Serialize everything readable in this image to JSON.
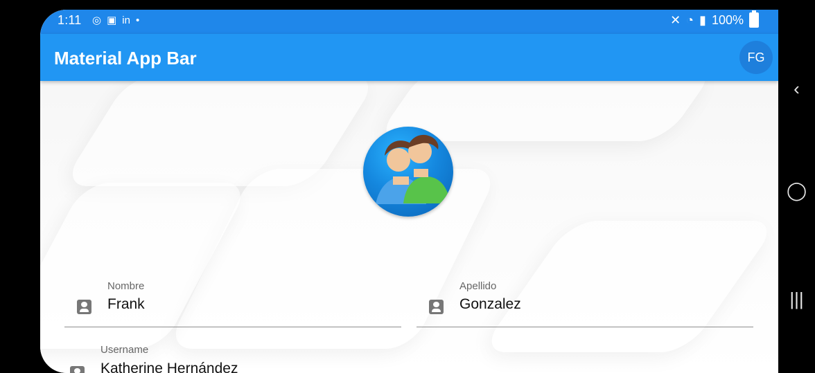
{
  "status_bar": {
    "time": "1:11",
    "battery": "100%",
    "left_icons": [
      "whatsapp-icon",
      "image-icon",
      "linkedin-icon",
      "dot-icon"
    ],
    "right_icons": [
      "mute-icon",
      "wifi-icon",
      "signal-icon",
      "battery-icon"
    ]
  },
  "app_bar": {
    "title": "Material App Bar",
    "avatar_initials": "FG"
  },
  "profile": {
    "avatar_icon": "users-icon"
  },
  "form": {
    "nombre": {
      "label": "Nombre",
      "value": "Frank"
    },
    "apellido": {
      "label": "Apellido",
      "value": "Gonzalez"
    },
    "username": {
      "label": "Username",
      "value": "Katherine Hernández"
    }
  },
  "navigation": {
    "back_icon": "back-icon",
    "home_icon": "home-icon",
    "recent_icon": "recent-apps-icon"
  },
  "colors": {
    "app_bar": "#2196f3",
    "status_bar": "#1f87ea",
    "avatar_chip": "#1e7fdc"
  }
}
